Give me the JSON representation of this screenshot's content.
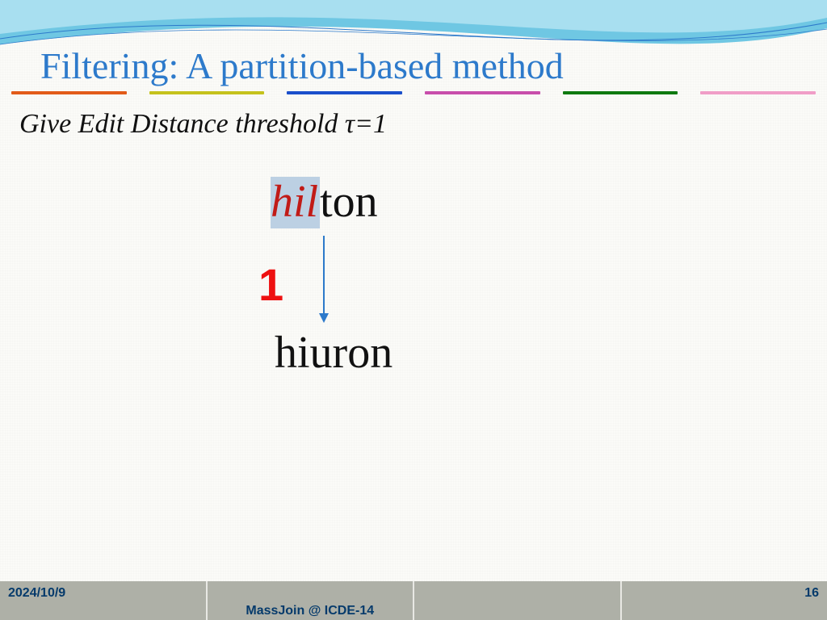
{
  "title": "Filtering: A partition-based method",
  "subtitle": "Give Edit Distance threshold τ=1",
  "word_top_prefix": "hil",
  "word_top_suffix": "ton",
  "arrow_label": "1",
  "word_bottom": "hiuron",
  "rules": [
    "#e25b19",
    "#c5c21c",
    "#1a4fcb",
    "#c84eab",
    "#0f7a10",
    "#f09ec7"
  ],
  "footer": {
    "date": "2024/10/9",
    "venue": "MassJoin @ ICDE-14",
    "page": "16"
  }
}
